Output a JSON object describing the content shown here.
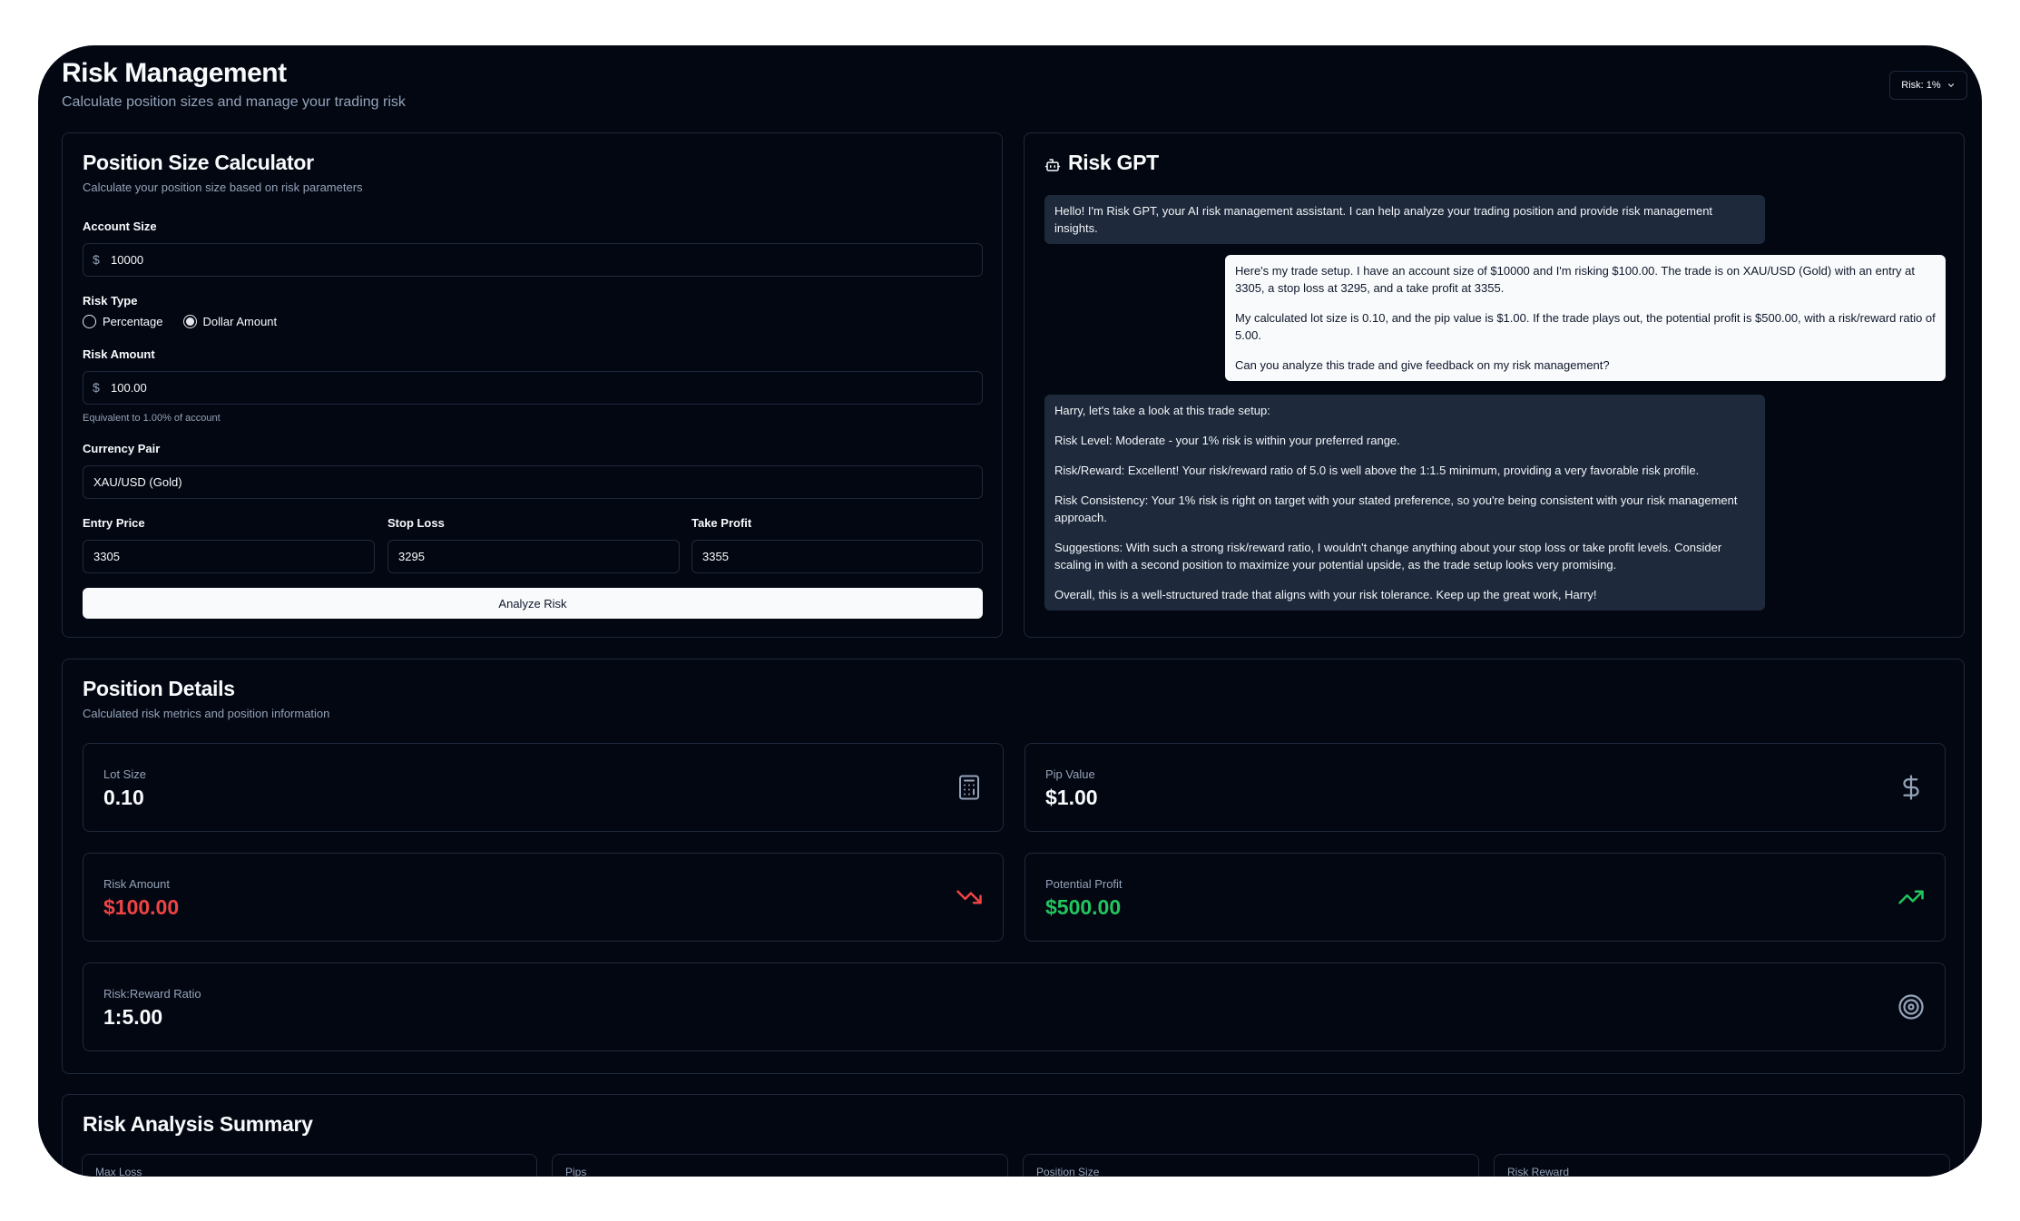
{
  "header": {
    "title": "Risk Management",
    "subtitle": "Calculate position sizes and manage your trading risk",
    "risk_selector": "Risk: 1%"
  },
  "calculator": {
    "title": "Position Size Calculator",
    "description": "Calculate your position size based on risk parameters",
    "account_size": {
      "label": "Account Size",
      "prefix": "$",
      "value": "10000"
    },
    "risk_type": {
      "label": "Risk Type",
      "options": [
        "Percentage",
        "Dollar Amount"
      ],
      "selected": "Dollar Amount"
    },
    "risk_amount": {
      "label": "Risk Amount",
      "prefix": "$",
      "value": "100.00",
      "hint": "Equivalent to 1.00% of account"
    },
    "currency_pair": {
      "label": "Currency Pair",
      "value": "XAU/USD (Gold)"
    },
    "entry_price": {
      "label": "Entry Price",
      "value": "3305"
    },
    "stop_loss": {
      "label": "Stop Loss",
      "value": "3295"
    },
    "take_profit": {
      "label": "Take Profit",
      "value": "3355"
    },
    "analyze_button": "Analyze Risk"
  },
  "risk_gpt": {
    "title": "Risk GPT",
    "messages": [
      {
        "role": "assistant",
        "paragraphs": [
          "Hello! I'm Risk GPT, your AI risk management assistant. I can help analyze your trading position and provide risk management insights."
        ]
      },
      {
        "role": "user",
        "paragraphs": [
          "Here's my trade setup. I have an account size of $10000 and I'm risking $100.00. The trade is on XAU/USD (Gold) with an entry at 3305, a stop loss at 3295, and a take profit at 3355.",
          "My calculated lot size is 0.10, and the pip value is $1.00. If the trade plays out, the potential profit is $500.00, with a risk/reward ratio of 5.00.",
          "Can you analyze this trade and give feedback on my risk management?"
        ]
      },
      {
        "role": "assistant",
        "paragraphs": [
          "Harry, let's take a look at this trade setup:",
          "Risk Level: Moderate - your 1% risk is within your preferred range.",
          "Risk/Reward: Excellent! Your risk/reward ratio of 5.0 is well above the 1:1.5 minimum, providing a very favorable risk profile.",
          "Risk Consistency: Your 1% risk is right on target with your stated preference, so you're being consistent with your risk management approach.",
          "Suggestions: With such a strong risk/reward ratio, I wouldn't change anything about your stop loss or take profit levels. Consider scaling in with a second position to maximize your potential upside, as the trade setup looks very promising.",
          "Overall, this is a well-structured trade that aligns with your risk tolerance. Keep up the great work, Harry!"
        ]
      }
    ]
  },
  "position_details": {
    "title": "Position Details",
    "description": "Calculated risk metrics and position information",
    "lot_size": {
      "label": "Lot Size",
      "value": "0.10",
      "icon": "calculator-icon"
    },
    "pip_value": {
      "label": "Pip Value",
      "value": "$1.00",
      "icon": "dollar-sign-icon"
    },
    "risk_amount": {
      "label": "Risk Amount",
      "value": "$100.00",
      "icon": "trending-down-icon",
      "color": "#ef4444"
    },
    "potential_profit": {
      "label": "Potential Profit",
      "value": "$500.00",
      "icon": "trending-up-icon",
      "color": "#22c55e"
    },
    "risk_reward": {
      "label": "Risk:Reward Ratio",
      "value": "1:5.00",
      "icon": "target-icon"
    }
  },
  "summary": {
    "title": "Risk Analysis Summary",
    "items": [
      "Max Loss",
      "Pips",
      "Position Size",
      "Risk Reward"
    ]
  }
}
